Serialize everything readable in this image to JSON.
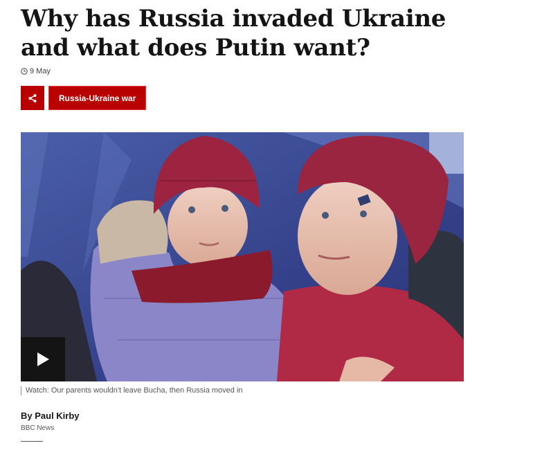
{
  "article": {
    "headline": "Why has Russia invaded Ukraine and what does Putin want?",
    "date": "9 May",
    "topic_label": "Russia-Ukraine war",
    "caption": "Watch: Our parents wouldn't leave Bucha, then Russia moved in",
    "byline": "By Paul Kirby",
    "source": "BBC News"
  },
  "icons": {
    "clock": "clock-icon",
    "share": "share-icon",
    "play": "play-icon"
  },
  "colors": {
    "accent": "#b80000",
    "text": "#141414",
    "muted": "#545658"
  }
}
